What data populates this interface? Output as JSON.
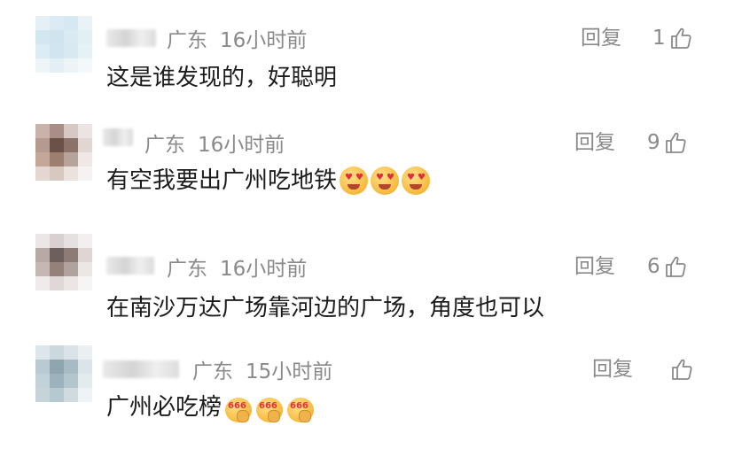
{
  "comments": [
    {
      "location": "广东",
      "time": "16小时前",
      "reply_label": "回复",
      "likes": "1",
      "text": "这是谁发现的，好聪明",
      "emojis": []
    },
    {
      "location": "广东",
      "time": "16小时前",
      "reply_label": "回复",
      "likes": "9",
      "text": "有空我要出广州吃地铁",
      "emojis": [
        "heart-eyes-emoji",
        "heart-eyes-emoji",
        "heart-eyes-emoji"
      ]
    },
    {
      "location": "广东",
      "time": "16小时前",
      "reply_label": "回复",
      "likes": "6",
      "text": "在南沙万达广场靠河边的广场，角度也可以",
      "emojis": []
    },
    {
      "location": "广东",
      "time": "15小时前",
      "reply_label": "回复",
      "likes": "",
      "text": "广州必吃榜",
      "emojis": [
        "666-thinking-emoji",
        "666-thinking-emoji",
        "666-thinking-emoji"
      ],
      "emoji_badge": "666"
    }
  ],
  "colors": {
    "meta": "#8a8a8a",
    "text": "#1c1c1c",
    "background": "#ffffff"
  }
}
